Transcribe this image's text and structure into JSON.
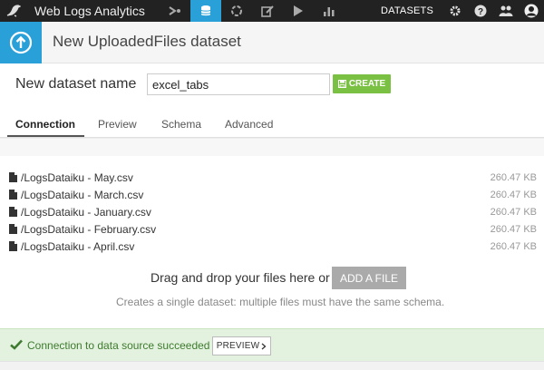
{
  "topnav": {
    "project_title": "Web Logs Analytics",
    "datasets_label": "DATASETS",
    "icons": [
      "flow-icon",
      "datasets-icon",
      "recipes-icon",
      "notebooks-icon",
      "jobs-icon",
      "dashboards-icon",
      "settings-icon",
      "help-icon",
      "users-icon",
      "user-avatar-icon"
    ],
    "active_color": "#2aa0d8"
  },
  "header": {
    "title": "New UploadedFiles dataset"
  },
  "form": {
    "name_label": "New dataset name",
    "name_value": "excel_tabs",
    "create_label": "CREATE"
  },
  "tabs": [
    {
      "label": "Connection",
      "active": true
    },
    {
      "label": "Preview",
      "active": false
    },
    {
      "label": "Schema",
      "active": false
    },
    {
      "label": "Advanced",
      "active": false
    }
  ],
  "files": [
    {
      "name": "/LogsDataiku - May.csv",
      "size": "260.47 KB"
    },
    {
      "name": "/LogsDataiku - March.csv",
      "size": "260.47 KB"
    },
    {
      "name": "/LogsDataiku - January.csv",
      "size": "260.47 KB"
    },
    {
      "name": "/LogsDataiku - February.csv",
      "size": "260.47 KB"
    },
    {
      "name": "/LogsDataiku - April.csv",
      "size": "260.47 KB"
    }
  ],
  "dropzone": {
    "text": "Drag and drop your files here or",
    "add_file_label": "ADD A FILE",
    "hint": "Creates a single dataset: multiple files must have the same schema."
  },
  "status": {
    "message": "Connection to data source succeeded",
    "preview_label": "PREVIEW",
    "color": "#3e7a2f"
  }
}
